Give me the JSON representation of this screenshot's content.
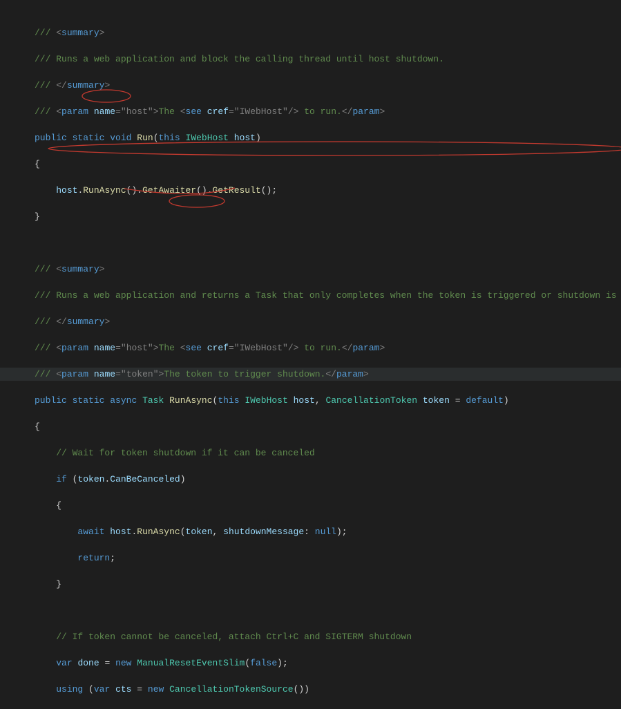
{
  "code": {
    "c1_summary_open": "summary",
    "c1_text": "Runs a web application and block the calling thread until host shutdown.",
    "c1_summary_close": "summary",
    "c1_param_name": "param",
    "c1_param_attr": "name",
    "c1_param_val": "\"host\"",
    "c1_param_text1": "The ",
    "c1_see": "see",
    "c1_cref": "cref",
    "c1_cref_val": "\"IWebHost\"",
    "c1_param_text2": " to run.",
    "kw_public": "public",
    "kw_static": "static",
    "kw_void": "void",
    "m_Run": "Run",
    "kw_this": "this",
    "t_IWebHost": "IWebHost",
    "p_host": "host",
    "p_host2": "host",
    "m_RunAsync": "RunAsync",
    "m_GetAwaiter": "GetAwaiter",
    "m_GetResult": "GetResult",
    "c2_text": "Runs a web application and returns a Task that only completes when the token is triggered or shutdown is t",
    "c2_param2_name": "param",
    "c2_param2_attr": "name",
    "c2_param2_val": "\"token\"",
    "c2_param2_text": "The token to trigger shutdown.",
    "kw_async": "async",
    "t_Task": "Task",
    "m_RunAsync2": "RunAsync",
    "t_CancellationToken": "CancellationToken",
    "p_token": "token",
    "kw_default": "default",
    "cmt_wait": "// Wait for token shutdown if it can be canceled",
    "kw_if": "if",
    "p_token2": "token",
    "prop_CanBeCanceled": "CanBeCanceled",
    "kw_await": "await",
    "p_host3": "host",
    "m_RunAsync3": "RunAsync",
    "p_token3": "token",
    "np_shutdownMessage": "shutdownMessage",
    "kw_null": "null",
    "kw_return": "return",
    "cmt_ctrlc": "// If token cannot be canceled, attach Ctrl+C and SIGTERM shutdown",
    "kw_var": "var",
    "v_done": "done",
    "kw_new": "new",
    "t_MRES": "ManualResetEventSlim",
    "kw_false": "false",
    "kw_using": "using",
    "kw_var2": "var",
    "v_cts": "cts",
    "kw_new2": "new",
    "t_CTS": "CancellationTokenSource"
  }
}
